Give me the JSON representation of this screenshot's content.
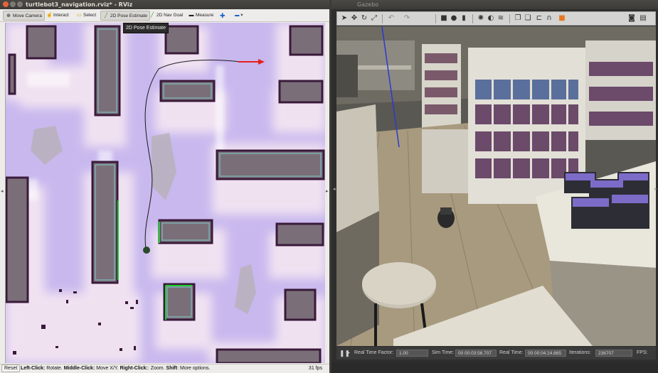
{
  "rviz": {
    "window_title": "turtlebot3_navigation.rviz* - RViz",
    "toolbar": [
      {
        "icon": "move-camera-icon",
        "label": "Move Camera"
      },
      {
        "icon": "interact-icon",
        "label": "Interact"
      },
      {
        "icon": "select-icon",
        "label": "Select"
      },
      {
        "icon": "pose-estimate-icon",
        "label": "2D Pose Estimate"
      },
      {
        "icon": "nav-goal-icon",
        "label": "2D Nav Goal"
      },
      {
        "icon": "measure-icon",
        "label": "Measure"
      }
    ],
    "tooltip": "2D Pose Estimate",
    "status": {
      "reset_label": "Reset",
      "hint": {
        "left_key": "Left-Click:",
        "left_desc": "Rotate.",
        "middle_key": "Middle-Click:",
        "middle_desc": "Move X/Y.",
        "right_key": "Right-Click:",
        "right_desc": ": Zoom.",
        "shift_key": "Shift",
        "shift_desc": ": More options."
      },
      "fps": "31 fps"
    },
    "colors": {
      "goal_arrow": "#e8201a",
      "path": "#1a1a1a",
      "laser": "#22cc33"
    }
  },
  "gazebo": {
    "window_title": "Gazebo",
    "status": {
      "real_time_factor_label": "Real Time Factor:",
      "real_time_factor": "1.00",
      "sim_time_label": "Sim Time:",
      "sim_time": "00 00:03:56.707",
      "real_time_label": "Real Time:",
      "real_time": "00 00:04:24.865",
      "iterations_label": "Iterations:",
      "iterations": "236707",
      "fps_label": "FPS:"
    }
  }
}
